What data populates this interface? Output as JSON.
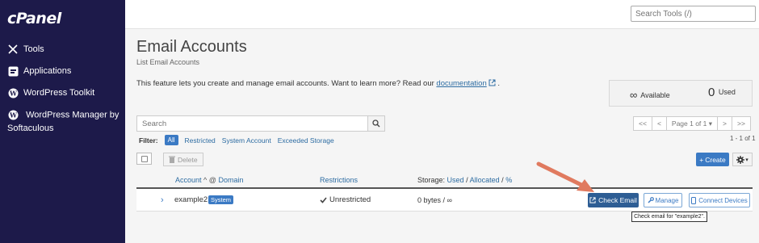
{
  "app": {
    "logo": "cPanel"
  },
  "sidebar": {
    "items": [
      {
        "label": "Tools",
        "icon": "tools-icon"
      },
      {
        "label": "Applications",
        "icon": "applications-icon"
      },
      {
        "label": "WordPress Toolkit",
        "icon": "wordpress-icon"
      },
      {
        "label": "WordPress Manager by Softaculous",
        "icon": "wordpress-icon"
      }
    ]
  },
  "header": {
    "search_placeholder": "Search Tools (/)"
  },
  "page": {
    "title": "Email Accounts",
    "subtitle": "List Email Accounts",
    "description": "This feature lets you create and manage email accounts. Want to learn more? Read our",
    "doc_link": "documentation",
    "desc_end": "."
  },
  "stats": {
    "available_symbol": "∞",
    "available_label": "Available",
    "used_count": "0",
    "used_label": "Used"
  },
  "search": {
    "placeholder": "Search"
  },
  "filter": {
    "label": "Filter:",
    "options": [
      "All",
      "Restricted",
      "System Account",
      "Exceeded Storage"
    ],
    "selected": "All"
  },
  "pagination": {
    "first": "<<",
    "prev": "<",
    "current": "Page 1 of 1",
    "next": ">",
    "last": ">>",
    "range": "1 - 1 of 1"
  },
  "toolbar": {
    "delete_label": "Delete",
    "create_label": "Create"
  },
  "table": {
    "headers": {
      "account": "Account",
      "at": "@",
      "domain": "Domain",
      "restrictions": "Restrictions",
      "storage_prefix": "Storage:",
      "used": "Used",
      "sep": "/",
      "allocated": "Allocated",
      "percent": "%"
    },
    "rows": [
      {
        "account": "example2",
        "badge": "System",
        "restriction": "Unrestricted",
        "storage": "0 bytes / ∞",
        "actions": {
          "check_email": "Check Email",
          "manage": "Manage",
          "connect_devices": "Connect Devices"
        }
      }
    ]
  },
  "tooltip": {
    "text": "Check email for \"example2\"."
  },
  "colors": {
    "sidebar_bg": "#1d1a4a",
    "accent": "#3b7ac4",
    "primary_button": "#2d5d94",
    "annotation_arrow": "#e07a5f"
  }
}
